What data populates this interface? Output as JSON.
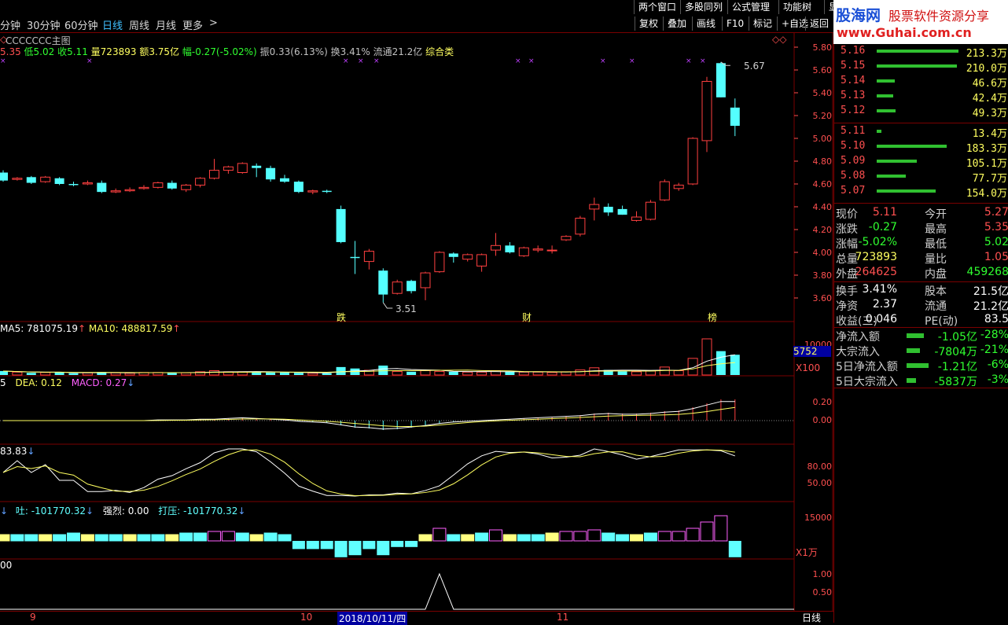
{
  "menubar": {
    "items": [
      "两个窗口",
      "多股同列",
      "公式管理",
      "功能树",
      "显"
    ]
  },
  "periods": [
    "分钟",
    "30分钟",
    "60分钟",
    "日线",
    "周线",
    "月线",
    "更多",
    ">"
  ],
  "active_period": "日线",
  "toolbar2": [
    "复权",
    "叠加",
    "画线",
    "F10",
    "标记",
    "+自选",
    "返回"
  ],
  "logo": {
    "brand": "股海网",
    "slogan": "股票软件资源分享",
    "url": "www.Guhai.com.cn"
  },
  "main_chart": {
    "title": "CCCCCCC主图",
    "info_line": {
      "open": "5.35",
      "low": "低5.02",
      "close": "收5.11",
      "volume": "量723893",
      "amount": "额3.75亿",
      "change": "幅-0.27(-5.02%)",
      "amplitude": "振0.33(6.13%)",
      "turnover": "换3.41%",
      "float": "流通21.2亿",
      "category": "综合类"
    },
    "high_label": "5.67",
    "low_label": "3.51",
    "markers": [
      "跌",
      "财",
      "榜"
    ],
    "y_ticks": [
      "5.80",
      "5.60",
      "5.40",
      "5.20",
      "5.00",
      "4.80",
      "4.60",
      "4.40",
      "4.20",
      "4.00",
      "3.80",
      "3.60"
    ]
  },
  "volume_panel": {
    "legend_ma5": "MA5: 781075.19",
    "legend_ma10": "MA10: 488817.59",
    "current": "5752",
    "unit": "X100",
    "y_tick": "10000"
  },
  "macd_panel": {
    "legend_dif": "5",
    "legend_dea": "DEA: 0.12",
    "legend_macd": "MACD: 0.27",
    "y_ticks": [
      "0.20",
      "0.00"
    ]
  },
  "kdj_panel": {
    "legend": "83.83",
    "y_ticks": [
      "80.00",
      "50.00"
    ]
  },
  "flow_panel": {
    "legend_tu": "吐: -101770.32",
    "legend_strong": "强烈: 0.00",
    "legend_press": "打压: -101770.32",
    "y_tick": "15000",
    "unit": "X1万"
  },
  "signal_panel": {
    "legend": "00",
    "y_ticks": [
      "1.00",
      "0.50"
    ]
  },
  "x_axis": {
    "labels": [
      "9",
      "10",
      "2018/10/11/四",
      "11"
    ],
    "period_button": "日线"
  },
  "order_book": {
    "asks": [
      {
        "price": "5.16",
        "volume": "213.3万",
        "bar": 1.0
      },
      {
        "price": "5.15",
        "volume": "210.0万",
        "bar": 0.98
      },
      {
        "price": "5.14",
        "volume": "46.6万",
        "bar": 0.22
      },
      {
        "price": "5.13",
        "volume": "42.4万",
        "bar": 0.2
      },
      {
        "price": "5.12",
        "volume": "49.3万",
        "bar": 0.23
      }
    ],
    "bids": [
      {
        "price": "5.11",
        "volume": "13.4万",
        "bar": 0.06
      },
      {
        "price": "5.10",
        "volume": "183.3万",
        "bar": 0.86
      },
      {
        "price": "5.09",
        "volume": "105.1万",
        "bar": 0.49
      },
      {
        "price": "5.08",
        "volume": "77.7万",
        "bar": 0.36
      },
      {
        "price": "5.07",
        "volume": "154.0万",
        "bar": 0.72
      }
    ]
  },
  "quote": [
    {
      "l1": "现价",
      "v1": "5.11",
      "c1": "#ff5050",
      "l2": "今开",
      "v2": "5.27",
      "c2": "#ff5050"
    },
    {
      "l1": "涨跌",
      "v1": "-0.27",
      "c1": "#30ff30",
      "l2": "最高",
      "v2": "5.35",
      "c2": "#ff5050"
    },
    {
      "l1": "涨幅",
      "v1": "-5.02%",
      "c1": "#30ff30",
      "l2": "最低",
      "v2": "5.02",
      "c2": "#30ff30"
    },
    {
      "l1": "总量",
      "v1": "723893",
      "c1": "#ffff60",
      "l2": "量比",
      "v2": "1.05",
      "c2": "#ff5050"
    },
    {
      "l1": "外盘",
      "v1": "264625",
      "c1": "#ff5050",
      "l2": "内盘",
      "v2": "459268",
      "c2": "#30ff30"
    }
  ],
  "fundamentals": [
    {
      "l1": "换手",
      "v1": "3.41%",
      "l2": "股本",
      "v2": "21.5亿"
    },
    {
      "l1": "净资",
      "v1": "2.37",
      "l2": "流通",
      "v2": "21.2亿"
    },
    {
      "l1": "收益(三)",
      "v1": "0.046",
      "l2": "PE(动)",
      "v2": "83.5"
    }
  ],
  "capital_flow": [
    {
      "label": "净流入额",
      "value": "-1.05亿",
      "pct": "-28%",
      "bar": 0.22
    },
    {
      "label": "大宗流入",
      "value": "-7804万",
      "pct": "-21%",
      "bar": 0.17
    },
    {
      "label": "5日净流入额",
      "value": "-1.21亿",
      "pct": "-6%",
      "bar": 0.28
    },
    {
      "label": "5日大宗流入",
      "value": "-5837万",
      "pct": "-3%",
      "bar": 0.12
    }
  ],
  "colors": {
    "up": "#ff4040",
    "down": "#54ffff",
    "frame": "#7a0000",
    "ma_white": "#ffffff",
    "ma_yellow": "#ffff60"
  },
  "candles": [
    [
      4.7,
      4.72,
      4.62,
      4.63
    ],
    [
      4.64,
      4.66,
      4.63,
      4.65
    ],
    [
      4.66,
      4.67,
      4.6,
      4.61
    ],
    [
      4.62,
      4.67,
      4.61,
      4.66
    ],
    [
      4.65,
      4.66,
      4.59,
      4.6
    ],
    [
      4.6,
      4.62,
      4.58,
      4.59
    ],
    [
      4.6,
      4.63,
      4.59,
      4.61
    ],
    [
      4.61,
      4.63,
      4.52,
      4.53
    ],
    [
      4.53,
      4.56,
      4.52,
      4.54
    ],
    [
      4.54,
      4.57,
      4.53,
      4.55
    ],
    [
      4.56,
      4.59,
      4.55,
      4.57
    ],
    [
      4.57,
      4.62,
      4.56,
      4.61
    ],
    [
      4.61,
      4.63,
      4.55,
      4.56
    ],
    [
      4.55,
      4.6,
      4.53,
      4.59
    ],
    [
      4.59,
      4.66,
      4.57,
      4.65
    ],
    [
      4.65,
      4.82,
      4.64,
      4.72
    ],
    [
      4.72,
      4.76,
      4.69,
      4.75
    ],
    [
      4.7,
      4.79,
      4.69,
      4.78
    ],
    [
      4.76,
      4.78,
      4.66,
      4.74
    ],
    [
      4.74,
      4.76,
      4.62,
      4.64
    ],
    [
      4.65,
      4.68,
      4.61,
      4.62
    ],
    [
      4.62,
      4.63,
      4.52,
      4.53
    ],
    [
      4.53,
      4.55,
      4.51,
      4.54
    ],
    [
      4.54,
      4.55,
      4.52,
      4.53
    ],
    [
      4.38,
      4.41,
      4.08,
      4.09
    ],
    [
      3.96,
      4.1,
      3.81,
      3.95
    ],
    [
      3.92,
      4.03,
      3.85,
      4.01
    ],
    [
      3.84,
      3.86,
      3.56,
      3.63
    ],
    [
      3.64,
      3.76,
      3.63,
      3.74
    ],
    [
      3.75,
      3.76,
      3.64,
      3.66
    ],
    [
      3.69,
      3.83,
      3.58,
      3.82
    ],
    [
      3.83,
      4.01,
      3.82,
      4.0
    ],
    [
      3.99,
      4.0,
      3.91,
      3.96
    ],
    [
      3.94,
      3.99,
      3.92,
      3.98
    ],
    [
      3.88,
      3.99,
      3.83,
      3.98
    ],
    [
      4.02,
      4.17,
      3.97,
      4.06
    ],
    [
      4.06,
      4.09,
      3.99,
      4.0
    ],
    [
      3.97,
      4.05,
      3.96,
      4.04
    ],
    [
      4.02,
      4.06,
      4.0,
      4.03
    ],
    [
      4.02,
      4.06,
      3.99,
      4.02
    ],
    [
      4.11,
      4.15,
      4.1,
      4.14
    ],
    [
      4.16,
      4.32,
      4.14,
      4.3
    ],
    [
      4.38,
      4.48,
      4.28,
      4.42
    ],
    [
      4.4,
      4.43,
      4.32,
      4.35
    ],
    [
      4.38,
      4.41,
      4.33,
      4.33
    ],
    [
      4.28,
      4.36,
      4.27,
      4.31
    ],
    [
      4.29,
      4.46,
      4.28,
      4.44
    ],
    [
      4.46,
      4.64,
      4.45,
      4.62
    ],
    [
      4.56,
      4.61,
      4.54,
      4.59
    ],
    [
      4.6,
      5.01,
      4.59,
      5.0
    ],
    [
      4.98,
      5.54,
      4.88,
      5.5
    ],
    [
      5.66,
      5.67,
      5.36,
      5.36
    ],
    [
      5.27,
      5.35,
      5.02,
      5.11
    ]
  ],
  "volume": [
    11,
    8,
    6,
    7,
    7,
    5,
    6,
    8,
    6,
    5,
    7,
    7,
    7,
    6,
    9,
    12,
    9,
    9,
    8,
    7,
    7,
    6,
    5,
    5,
    22,
    18,
    13,
    26,
    10,
    9,
    12,
    10,
    9,
    8,
    8,
    12,
    9,
    8,
    8,
    7,
    9,
    14,
    20,
    14,
    10,
    9,
    11,
    22,
    12,
    46,
    100,
    66,
    56
  ],
  "macd": [
    0,
    0,
    0,
    0,
    0,
    0,
    0,
    0,
    0,
    0,
    0,
    0.01,
    0.01,
    0.01,
    0.02,
    0.02,
    0.03,
    0.04,
    0.03,
    0.02,
    0.01,
    -0.01,
    -0.02,
    -0.03,
    -0.06,
    -0.09,
    -0.1,
    -0.12,
    -0.11,
    -0.09,
    -0.07,
    -0.04,
    -0.02,
    -0.01,
    0,
    0.01,
    0.02,
    0.03,
    0.04,
    0.05,
    0.06,
    0.07,
    0.09,
    0.1,
    0.09,
    0.09,
    0.1,
    0.12,
    0.13,
    0.17,
    0.22,
    0.27,
    0.27
  ],
  "flow": [
    4,
    4,
    4,
    4,
    4,
    5,
    4,
    4,
    4,
    4,
    4,
    4,
    4,
    5,
    5,
    6,
    6,
    5,
    4,
    5,
    4,
    -4,
    -4,
    -4,
    -8,
    -7,
    -4,
    -7,
    -3,
    -3,
    4,
    8,
    4,
    4,
    5,
    7,
    4,
    4,
    4,
    5,
    6,
    6,
    7,
    5,
    4,
    4,
    5,
    6,
    6,
    8,
    12,
    16,
    -8
  ],
  "signal_peak_index": 31
}
